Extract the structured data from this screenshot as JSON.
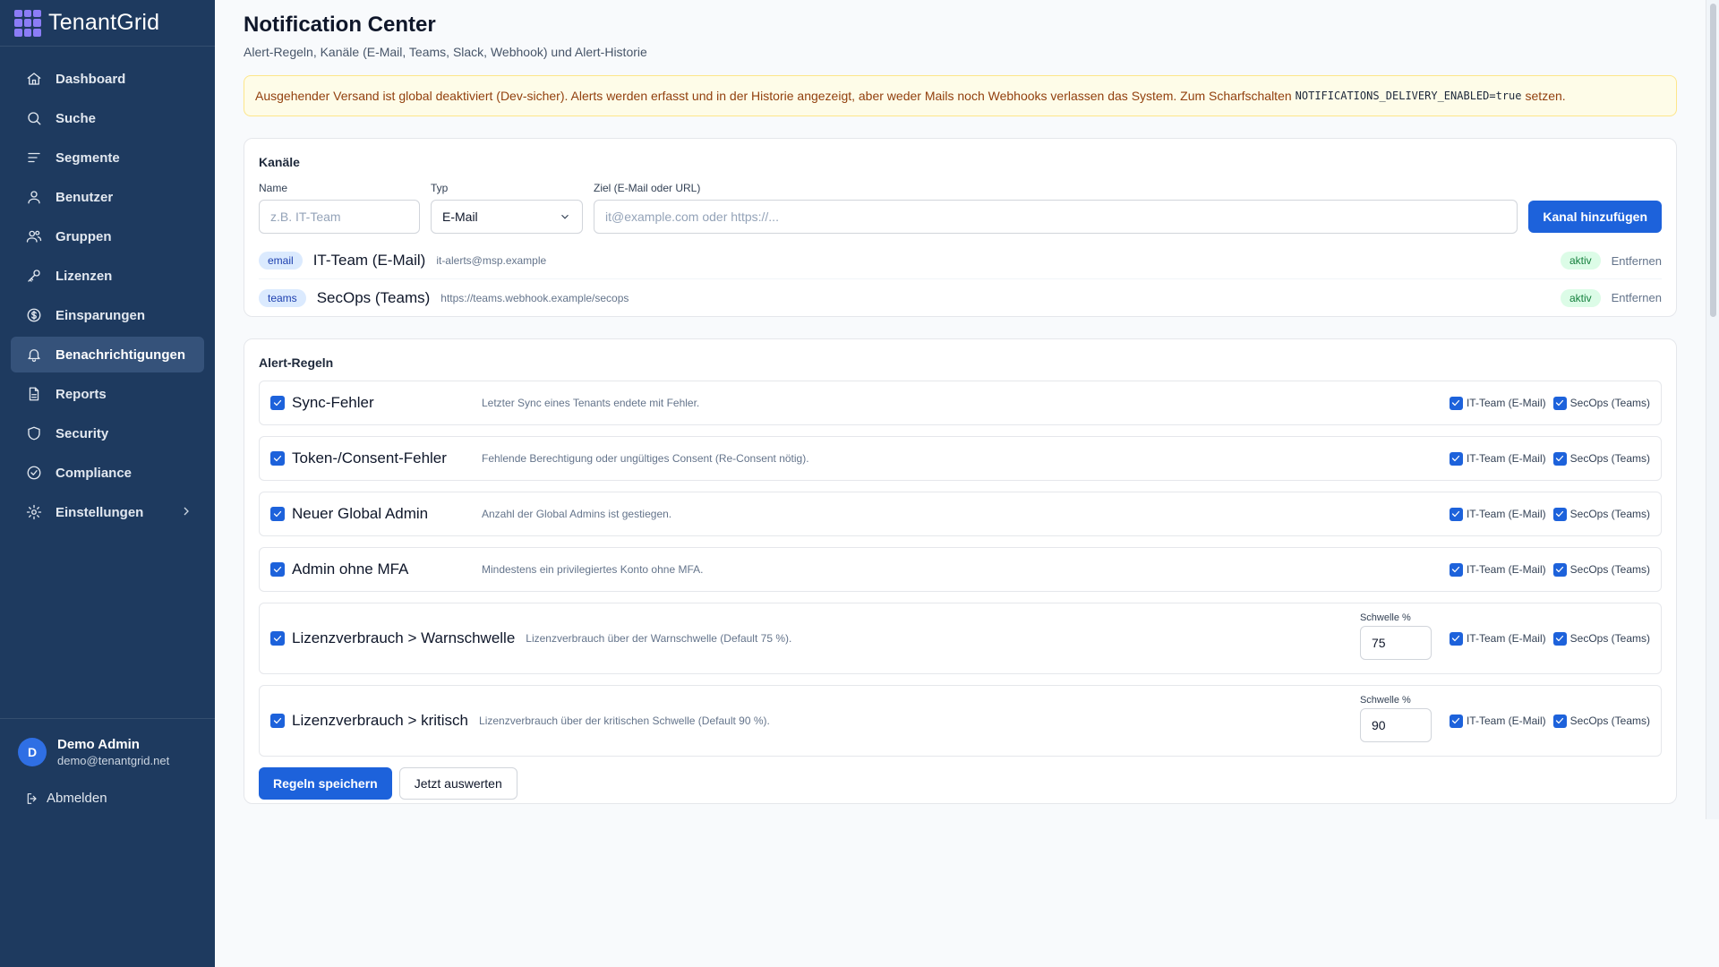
{
  "brand": {
    "name": "TenantGrid"
  },
  "nav": [
    {
      "label": "Dashboard",
      "icon": "home-icon"
    },
    {
      "label": "Suche",
      "icon": "search-icon"
    },
    {
      "label": "Segmente",
      "icon": "list-filter-icon"
    },
    {
      "label": "Benutzer",
      "icon": "user-icon"
    },
    {
      "label": "Gruppen",
      "icon": "users-icon"
    },
    {
      "label": "Lizenzen",
      "icon": "key-icon"
    },
    {
      "label": "Einsparungen",
      "icon": "dollar-circle-icon"
    },
    {
      "label": "Benachrichtigungen",
      "icon": "bell-icon",
      "active": true
    },
    {
      "label": "Reports",
      "icon": "file-icon"
    },
    {
      "label": "Security",
      "icon": "shield-icon"
    },
    {
      "label": "Compliance",
      "icon": "check-circle-icon"
    },
    {
      "label": "Einstellungen",
      "icon": "gear-icon"
    }
  ],
  "user": {
    "initial": "D",
    "name": "Demo Admin",
    "email": "demo@tenantgrid.net",
    "logout_label": "Abmelden"
  },
  "page": {
    "title": "Notification Center",
    "subtitle": "Alert-Regeln, Kanäle (E-Mail, Teams, Slack, Webhook) und Alert-Historie"
  },
  "banner": {
    "text_before": "Ausgehender Versand ist global deaktiviert (Dev-sicher). Alerts werden erfasst und in der Historie angezeigt, aber weder Mails noch Webhooks verlassen das System. Zum Scharfschalten",
    "code": "NOTIFICATIONS_DELIVERY_ENABLED=true",
    "text_after": "setzen."
  },
  "channels_card": {
    "title": "Kanäle",
    "name_label": "Name",
    "name_placeholder": "z.B. IT-Team",
    "type_label": "Typ",
    "type_value": "E-Mail",
    "target_label": "Ziel (E-Mail oder URL)",
    "target_placeholder": "it@example.com oder https://...",
    "add_button": "Kanal hinzufügen",
    "channels": [
      {
        "type": "email",
        "name": "IT-Team (E-Mail)",
        "target": "it-alerts@msp.example",
        "status": "aktiv",
        "remove": "Entfernen"
      },
      {
        "type": "teams",
        "name": "SecOps (Teams)",
        "target": "https://teams.webhook.example/secops",
        "status": "aktiv",
        "remove": "Entfernen"
      }
    ]
  },
  "rules_card": {
    "title": "Alert-Regeln",
    "channel_a": "IT-Team (E-Mail)",
    "channel_b": "SecOps (Teams)",
    "threshold_label": "Schwelle %",
    "rules": [
      {
        "name": "Sync-Fehler",
        "description": "Letzter Sync eines Tenants endete mit Fehler."
      },
      {
        "name": "Token-/Consent-Fehler",
        "description": "Fehlende Berechtigung oder ungültiges Consent (Re-Consent nötig)."
      },
      {
        "name": "Neuer Global Admin",
        "description": "Anzahl der Global Admins ist gestiegen."
      },
      {
        "name": "Admin ohne MFA",
        "description": "Mindestens ein privilegiertes Konto ohne MFA."
      },
      {
        "name": "Lizenzverbrauch > Warnschwelle",
        "description": "Lizenzverbrauch über der Warnschwelle (Default 75 %).",
        "threshold": "75"
      },
      {
        "name": "Lizenzverbrauch > kritisch",
        "description": "Lizenzverbrauch über der kritischen Schwelle (Default 90 %).",
        "threshold": "90"
      }
    ],
    "save_button": "Regeln speichern",
    "evaluate_button": "Jetzt auswerten"
  }
}
